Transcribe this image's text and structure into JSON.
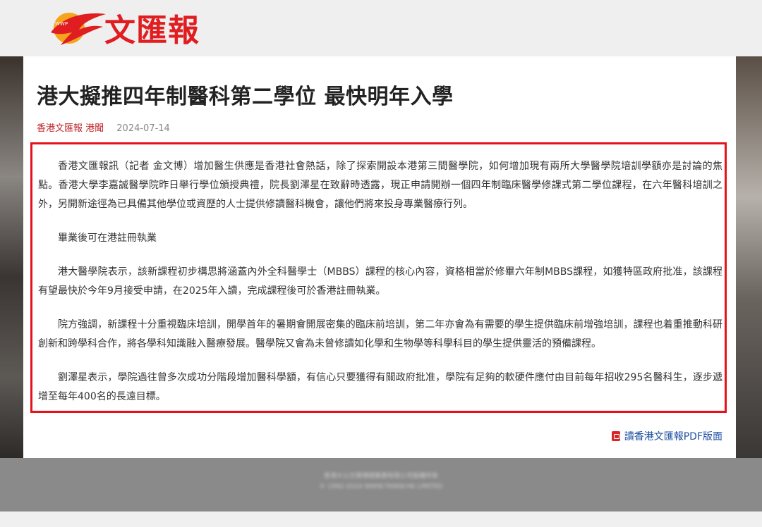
{
  "brand": {
    "logo_text": "文匯報",
    "logo_badge": "WWP"
  },
  "article": {
    "title": "港大擬推四年制醫科第二學位 最快明年入學",
    "source": "香港文匯報 港聞",
    "date": "2024-07-14",
    "paragraphs": [
      "香港文匯報訊（記者 金文博）增加醫生供應是香港社會熱話，除了探索開設本港第三間醫學院，如何增加現有兩所大學醫學院培訓學額亦是討論的焦點。香港大學李嘉誠醫學院昨日舉行學位頒授典禮，院長劉澤星在致辭時透露，現正申請開辦一個四年制臨床醫學修課式第二學位課程，在六年醫科培訓之外，另開新途徑為已具備其他學位或資歷的人士提供修讀醫科機會，讓他們將來投身專業醫療行列。",
      "畢業後可在港註冊執業",
      "港大醫學院表示，該新課程初步構思將涵蓋內外全科醫學士（MBBS）課程的核心內容，資格相當於修畢六年制MBBS課程，如獲特區政府批准，該課程有望最快於今年9月接受申請，在2025年入讀，完成課程後可於香港註冊執業。",
      "院方強調，新課程十分重視臨床培訓，開學首年的暑期會開展密集的臨床前培訓，第二年亦會為有需要的學生提供臨床前增強培訓，課程也着重推動科研創新和跨學科合作，將各學科知識融入醫療發展。醫學院又會為未曾修讀如化學和生物學等科學科目的學生提供靈活的預備課程。",
      "劉澤星表示，學院過往曾多次成功分階段增加醫科學額，有信心只要獲得有關政府批准，學院有足夠的軟硬件應付由目前每年招收295名醫科生，逐步遞增至每年400名的長遠目標。"
    ],
    "pdf_link": "讀香港文匯報PDF版面"
  },
  "footer": {
    "line1": "香港大公文匯傳媒集團有限公司版權所有",
    "line2": "© 1992-2024 WWW.TKWW.HK LIMITED"
  },
  "colors": {
    "brand_red": "#e01d20",
    "highlight_border": "#e5121b",
    "link_blue": "#1a4da0"
  }
}
